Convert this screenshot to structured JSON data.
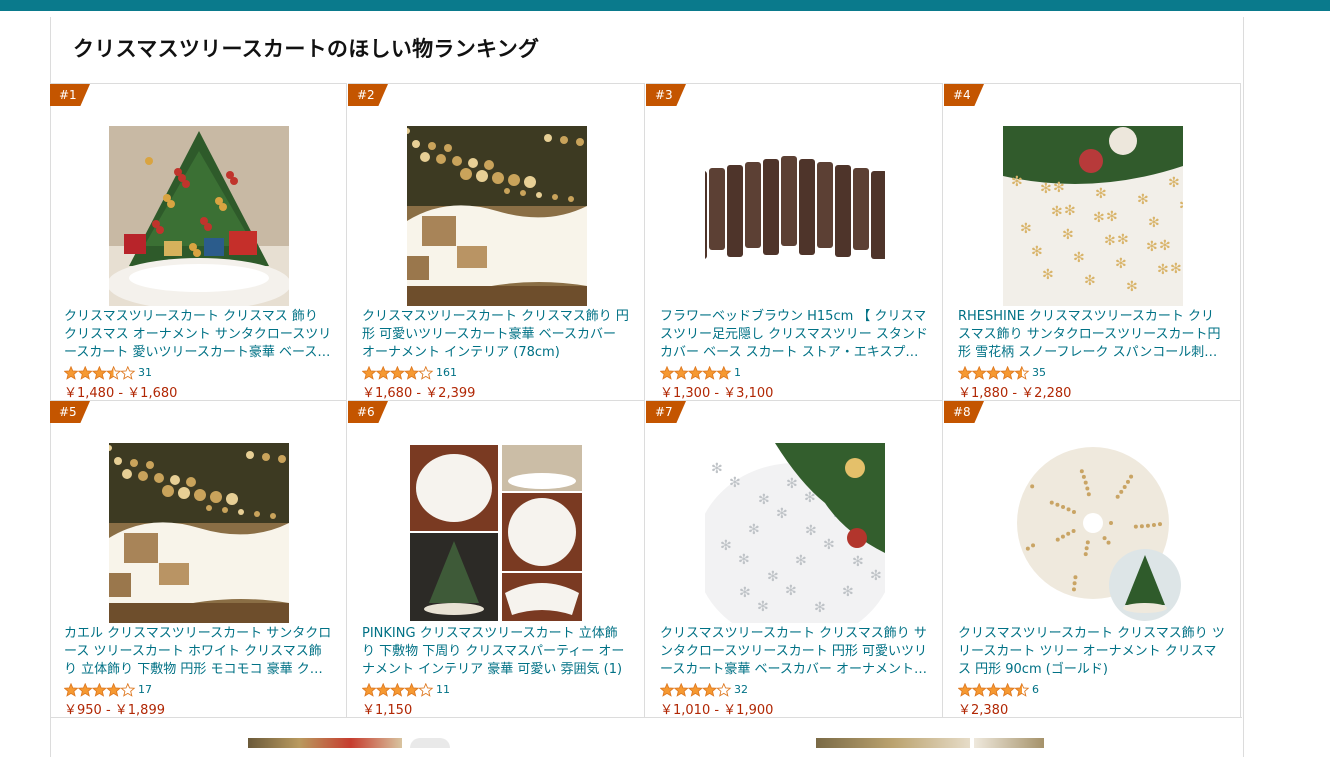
{
  "page": {
    "title": "クリスマスツリースカートのほしい物ランキング"
  },
  "colors": {
    "topbar": "#0a7a8c",
    "rank_badge": "#c45500",
    "link": "#007185",
    "price": "#b12704",
    "star": "#f69931"
  },
  "products": [
    {
      "rank": "#1",
      "title": "クリスマスツリースカート クリスマス 飾り クリスマス オーナメント サンタクロースツリースカート 愛いツリースカート豪華 ベースカ…",
      "rating": 3.5,
      "rating_count": "31",
      "price": "￥1,480 - ￥1,680",
      "image": "tree-with-gifts-white-skirt"
    },
    {
      "rank": "#2",
      "title": "クリスマスツリースカート クリスマス飾り 円形 可愛いツリースカート豪華 ベースカバー オーナメント インテリア (78cm)",
      "rating": 4.0,
      "rating_count": "161",
      "price": "￥1,680 - ￥2,399",
      "image": "fluffy-white-skirt-gifts"
    },
    {
      "rank": "#3",
      "title": "フラワーベッドブラウン H15cm 【 クリスマスツリー足元隠し クリスマスツリー スタンドカバー ベース スカート ストア・エキスプレ…",
      "rating": 5.0,
      "rating_count": "1",
      "price": "￥1,300 - ￥3,100",
      "image": "brown-wooden-fence"
    },
    {
      "rank": "#4",
      "title": "RHESHINE クリスマスツリースカート クリスマス飾り サンタクロースツリースカート円形 雪花柄 スノーフレーク スパンコール刺繍 可…",
      "rating": 4.5,
      "rating_count": "35",
      "price": "￥1,880 - ￥2,280",
      "image": "snowflake-embroidered-skirt"
    },
    {
      "rank": "#5",
      "title": "カエル クリスマスツリースカート サンタクロース ツリースカート ホワイト クリスマス飾り 立体飾り 下敷物 円形 モコモコ 豪華 クリス…",
      "rating": 4.0,
      "rating_count": "17",
      "price": "￥950 - ￥1,899",
      "image": "fluffy-white-skirt-gifts"
    },
    {
      "rank": "#6",
      "title": "PINKING クリスマスツリースカート 立体飾り 下敷物 下周り クリスマスパーティー オーナメント インテリア 豪華 可愛い 雰囲気 (1)",
      "rating": 4.0,
      "rating_count": "11",
      "price": "￥1,150",
      "image": "fur-skirt-collage"
    },
    {
      "rank": "#7",
      "title": "クリスマスツリースカート クリスマス飾り サンタクロースツリースカート 円形 可愛いツリースカート豪華 ベースカバー オーナメント …",
      "rating": 4.0,
      "rating_count": "32",
      "price": "￥1,010 - ￥1,900",
      "image": "silver-snowflake-skirt-pine"
    },
    {
      "rank": "#8",
      "title": "クリスマスツリースカート クリスマス飾り ツリースカート ツリー オーナメント クリスマス 円形 90cm (ゴールド)",
      "rating": 4.5,
      "rating_count": "6",
      "price": "￥2,380",
      "image": "gold-dot-round-skirt"
    }
  ]
}
